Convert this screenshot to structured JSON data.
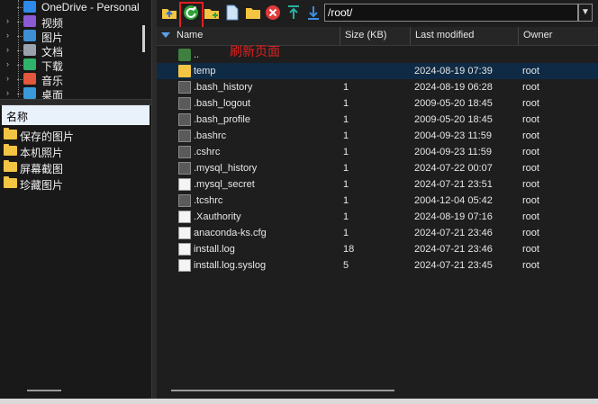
{
  "tree": {
    "items": [
      {
        "label": "OneDrive - Personal",
        "icon": "onedrive-icon",
        "color": "#2e8bea",
        "expand": false
      },
      {
        "label": "视频",
        "icon": "videos-icon",
        "color": "#8b5bd6",
        "expand": true
      },
      {
        "label": "图片",
        "icon": "pictures-icon",
        "color": "#3d8fd6",
        "expand": true
      },
      {
        "label": "文档",
        "icon": "documents-icon",
        "color": "#9aa3ad",
        "expand": true
      },
      {
        "label": "下载",
        "icon": "downloads-icon",
        "color": "#2fb36a",
        "expand": true
      },
      {
        "label": "音乐",
        "icon": "music-icon",
        "color": "#e2573d",
        "expand": true
      },
      {
        "label": "桌面",
        "icon": "desktop-icon",
        "color": "#3a9ad9",
        "expand": true
      }
    ]
  },
  "left_list": {
    "header": "名称",
    "folders": [
      "保存的图片",
      "本机照片",
      "屏幕截图",
      "珍藏图片"
    ]
  },
  "toolbar": {
    "path": "/root/",
    "annotation": "刷新页面"
  },
  "columns": {
    "name": "Name",
    "size": "Size (KB)",
    "modified": "Last modified",
    "owner": "Owner"
  },
  "files": [
    {
      "name": "..",
      "size": "",
      "modified": "",
      "owner": "",
      "type": "up"
    },
    {
      "name": "temp",
      "size": "",
      "modified": "2024-08-19 07:39",
      "owner": "root",
      "type": "folder"
    },
    {
      "name": ".bash_history",
      "size": "1",
      "modified": "2024-08-19 06:28",
      "owner": "root",
      "type": "file"
    },
    {
      "name": ".bash_logout",
      "size": "1",
      "modified": "2009-05-20 18:45",
      "owner": "root",
      "type": "file"
    },
    {
      "name": ".bash_profile",
      "size": "1",
      "modified": "2009-05-20 18:45",
      "owner": "root",
      "type": "file"
    },
    {
      "name": ".bashrc",
      "size": "1",
      "modified": "2004-09-23 11:59",
      "owner": "root",
      "type": "file"
    },
    {
      "name": ".cshrc",
      "size": "1",
      "modified": "2004-09-23 11:59",
      "owner": "root",
      "type": "file"
    },
    {
      "name": ".mysql_history",
      "size": "1",
      "modified": "2024-07-22 00:07",
      "owner": "root",
      "type": "file"
    },
    {
      "name": ".mysql_secret",
      "size": "1",
      "modified": "2024-07-21 23:51",
      "owner": "root",
      "type": "blank"
    },
    {
      "name": ".tcshrc",
      "size": "1",
      "modified": "2004-12-04 05:42",
      "owner": "root",
      "type": "file"
    },
    {
      "name": ".Xauthority",
      "size": "1",
      "modified": "2024-08-19 07:16",
      "owner": "root",
      "type": "blank"
    },
    {
      "name": "anaconda-ks.cfg",
      "size": "1",
      "modified": "2024-07-21 23:46",
      "owner": "root",
      "type": "doc"
    },
    {
      "name": "install.log",
      "size": "18",
      "modified": "2024-07-21 23:46",
      "owner": "root",
      "type": "doc"
    },
    {
      "name": "install.log.syslog",
      "size": "5",
      "modified": "2024-07-21 23:45",
      "owner": "root",
      "type": "doc"
    }
  ]
}
